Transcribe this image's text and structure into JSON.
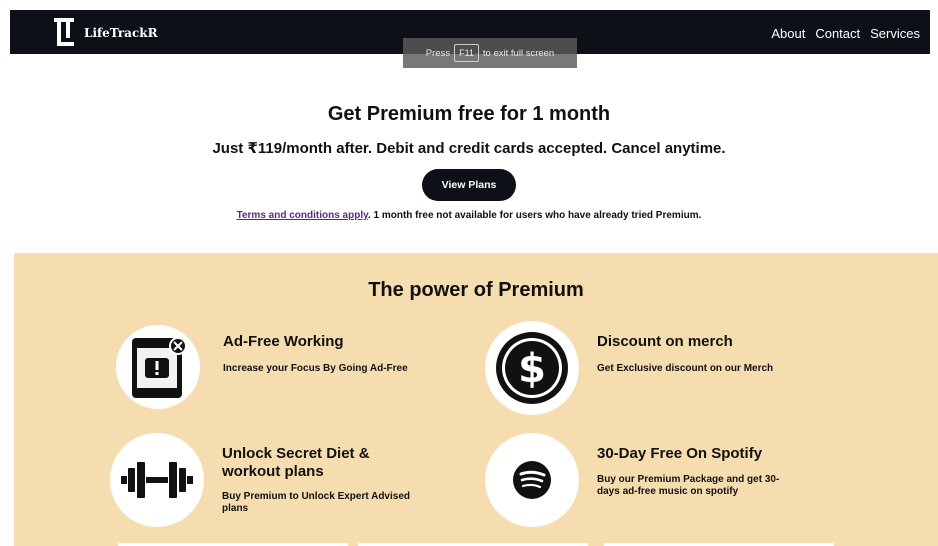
{
  "nav": {
    "brand": "LifeTrackR",
    "links": [
      "About",
      "Contact",
      "Services"
    ]
  },
  "fullscreen_toast": {
    "prefix": "Press",
    "key": "F11",
    "suffix": "to exit full screen"
  },
  "hero": {
    "title": "Get Premium free for 1 month",
    "subtitle": "Just ₹119/month after. Debit and credit cards accepted. Cancel anytime.",
    "cta_label": "View Plans",
    "terms_link": "Terms and conditions apply",
    "terms_rest": ". 1 month free not available for users who have already tried Premium."
  },
  "premium": {
    "title": "The power of Premium",
    "features": [
      {
        "title": "Ad-Free Working",
        "desc": "Increase your Focus By Going Ad-Free",
        "icon": "phone-ad-block-icon"
      },
      {
        "title": "Discount on merch",
        "desc": "Get Exclusive discount on our Merch",
        "icon": "dollar-coin-icon"
      },
      {
        "title": "Unlock Secret Diet & workout plans",
        "desc": "Buy Premium to Unlock Expert Advised plans",
        "icon": "dumbbell-icon"
      },
      {
        "title": "30-Day Free On Spotify",
        "desc": "Buy our Premium Package and get 30-days ad-free music on spotify",
        "icon": "spotify-icon"
      }
    ]
  },
  "colors": {
    "nav_bg": "#0d1117",
    "premium_bg": "#f5ddb0",
    "link": "#5a2a86"
  }
}
